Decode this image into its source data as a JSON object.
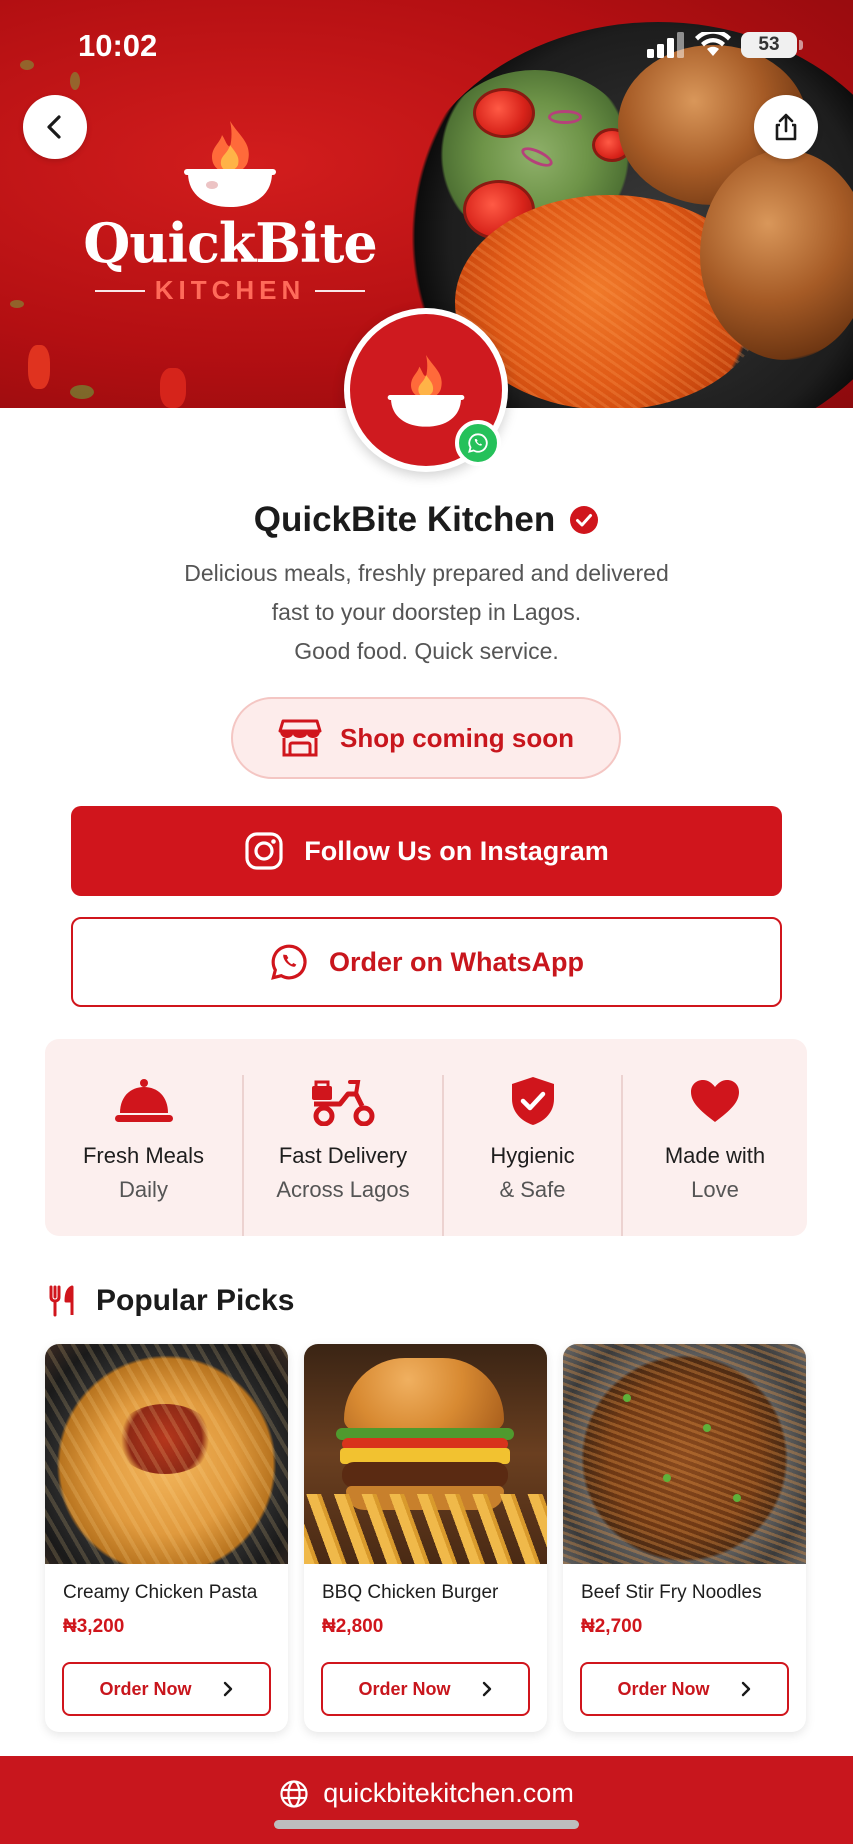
{
  "status_bar": {
    "time": "10:02",
    "battery": "53"
  },
  "hero": {
    "brand_name": "QuickBite",
    "brand_sub": "KITCHEN",
    "back_icon": "chevron-left-icon",
    "share_icon": "share-icon"
  },
  "profile": {
    "name": "QuickBite Kitchen",
    "verified_icon": "verified-check-icon",
    "bio_line_1": "Delicious meals, freshly prepared and delivered",
    "bio_line_2": "fast to your doorstep in Lagos.",
    "bio_line_3": "Good food. Quick service."
  },
  "actions": {
    "shop_label": "Shop coming soon",
    "instagram_label": "Follow Us on Instagram",
    "whatsapp_label": "Order on WhatsApp"
  },
  "features": [
    {
      "icon": "cloche-icon",
      "line1": "Fresh Meals",
      "line2": "Daily"
    },
    {
      "icon": "scooter-icon",
      "line1": "Fast Delivery",
      "line2": "Across Lagos"
    },
    {
      "icon": "shield-check-icon",
      "line1": "Hygienic",
      "line2": "& Safe"
    },
    {
      "icon": "heart-icon",
      "line1": "Made with",
      "line2": "Love"
    }
  ],
  "popular": {
    "title": "Popular Picks",
    "items": [
      {
        "name": "Creamy Chicken Pasta",
        "price": "₦3,200",
        "cta": "Order Now"
      },
      {
        "name": "BBQ Chicken Burger",
        "price": "₦2,800",
        "cta": "Order Now"
      },
      {
        "name": "Beef Stir Fry Noodles",
        "price": "₦2,700",
        "cta": "Order Now"
      }
    ]
  },
  "footer": {
    "website": "quickbitekitchen.com"
  },
  "colors": {
    "brand_red": "#d0151c",
    "whatsapp_green": "#25c15a",
    "tint": "#fcefee"
  }
}
